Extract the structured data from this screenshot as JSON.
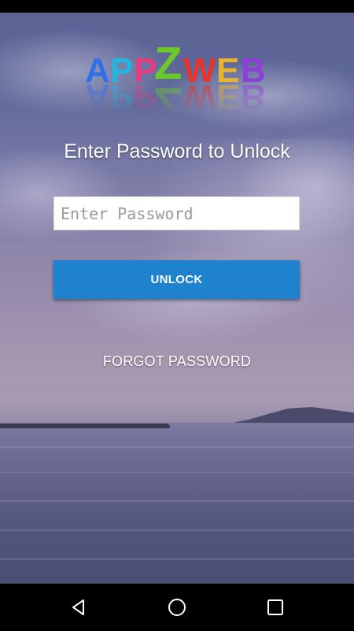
{
  "app": {
    "logo_text": "APPZWEB"
  },
  "lock_screen": {
    "title": "Enter Password to Unlock",
    "password_placeholder": "Enter Password",
    "password_value": "",
    "unlock_label": "UNLOCK",
    "forgot_label": "FORGOT PASSWORD"
  },
  "navigation": {
    "icons": [
      "back-icon",
      "home-icon",
      "recents-icon"
    ]
  },
  "colors": {
    "unlock_button": "#1e82cf",
    "nav_bar": "#000000",
    "text": "#ffffff"
  }
}
